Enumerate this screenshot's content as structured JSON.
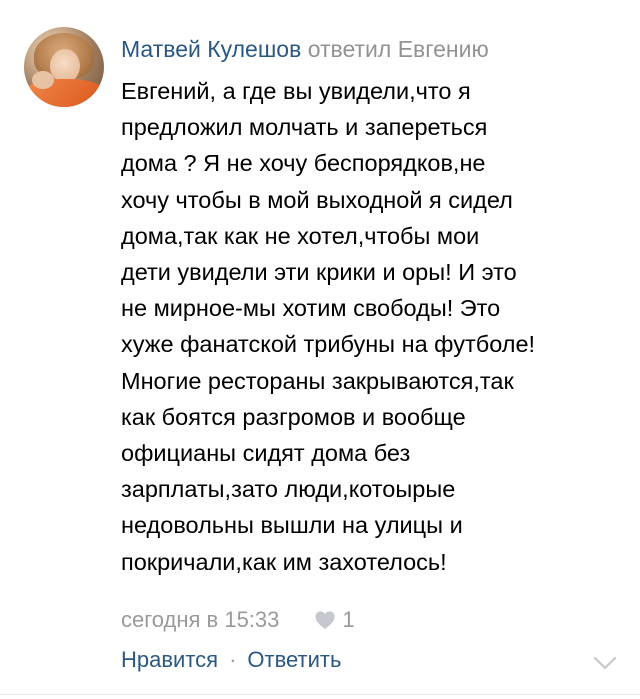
{
  "comment": {
    "author": "Матвей Кулешов",
    "reply_to": "ответил Евгению",
    "text_lines": [
      "Евгений, а где вы увидели,что я",
      "предложил молчать и запереться",
      "дома ? Я не хочу беспорядков,не",
      "хочу чтобы в мой выходной я сидел",
      "дома,так как не хотел,чтобы мои",
      "дети увидели эти крики и оры! И это",
      "не мирное-мы хотим свободы! Это",
      "хуже фанатской трибуны на футболе!",
      "Многие рестораны закрываются,так",
      "как боятся разгромов и вообще",
      "официаны сидят дома без",
      "зарплаты,зато люди,котоырые",
      "недовольны вышли на улицы и",
      "покричали,как им захотелось!"
    ],
    "timestamp": "сегодня в 15:33",
    "likes": "1",
    "like_label": "Нравится",
    "separator": "·",
    "reply_label": "Ответить"
  },
  "icons": {
    "like": "heart-icon",
    "expand": "chevron-down-icon"
  },
  "colors": {
    "link": "#2a5885",
    "muted": "#939393",
    "text": "#000000",
    "divider": "#e7e8ec"
  }
}
